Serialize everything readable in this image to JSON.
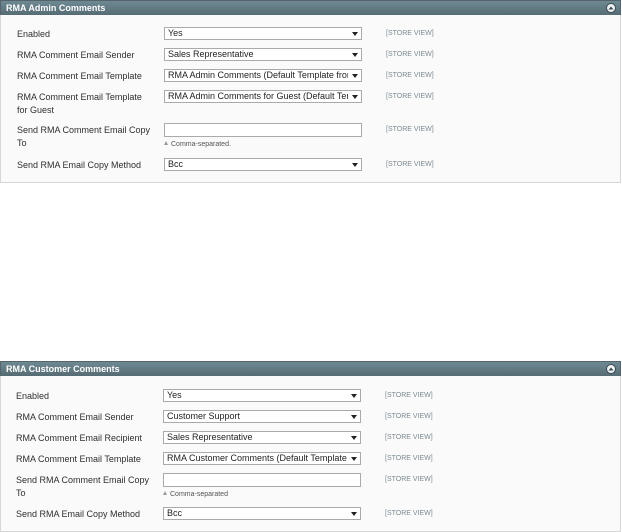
{
  "admin": {
    "title": "RMA Admin Comments",
    "enabled_label": "Enabled",
    "enabled_value": "Yes",
    "sender_label": "RMA Comment Email Sender",
    "sender_value": "Sales Representative",
    "template_label": "RMA Comment Email Template",
    "template_value": "RMA Admin Comments (Default Template from",
    "guest_template_label": "RMA Comment Email Template for Guest",
    "guest_template_value": "RMA Admin Comments for Guest (Default Tem",
    "copy_to_label": "Send RMA Comment Email Copy To",
    "copy_to_value": "",
    "copy_to_note": "Comma-separated.",
    "copy_method_label": "Send RMA Email Copy Method",
    "copy_method_value": "Bcc",
    "scope": "[STORE VIEW]"
  },
  "customer": {
    "title": "RMA Customer Comments",
    "enabled_label": "Enabled",
    "enabled_value": "Yes",
    "sender_label": "RMA Comment Email Sender",
    "sender_value": "Customer Support",
    "recipient_label": "RMA Comment Email Recipient",
    "recipient_value": "Sales Representative",
    "template_label": "RMA Comment Email Template",
    "template_value": "RMA Customer Comments (Default Template f",
    "copy_to_label": "Send RMA Comment Email Copy To",
    "copy_to_value": "",
    "copy_to_note": "Comma-separated",
    "copy_method_label": "Send RMA Email Copy Method",
    "copy_method_value": "Bcc",
    "scope": "[STORE VIEW]"
  },
  "icons": {
    "collapse": "collapse-up-icon",
    "dropdown": "chevron-down-icon",
    "hint": "hint-triangle-icon"
  }
}
